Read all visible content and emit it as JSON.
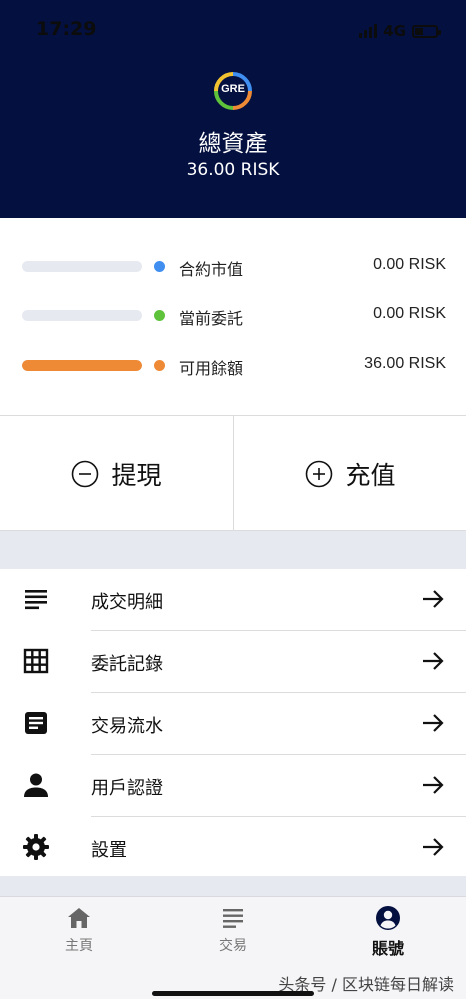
{
  "status_bar": {
    "time": "17:29",
    "network": "4G",
    "battery_level": 0.3
  },
  "header": {
    "logo_text": "GRE",
    "title": "總資產",
    "total_value": "36.00 RISK"
  },
  "breakdown": [
    {
      "label": "合約市值",
      "value": "0.00 RISK",
      "dot_color": "#3f8ef0",
      "fill_fraction": 0.0
    },
    {
      "label": "當前委託",
      "value": "0.00 RISK",
      "dot_color": "#5ec23b",
      "fill_fraction": 0.0
    },
    {
      "label": "可用餘額",
      "value": "36.00 RISK",
      "dot_color": "#ee8a36",
      "fill_fraction": 1.0
    }
  ],
  "actions": {
    "withdraw_label": "提現",
    "deposit_label": "充值"
  },
  "menu": [
    {
      "label": "成交明細",
      "icon": "list-lines-icon"
    },
    {
      "label": "委託記錄",
      "icon": "grid-icon"
    },
    {
      "label": "交易流水",
      "icon": "document-icon"
    },
    {
      "label": "用戶認證",
      "icon": "person-icon"
    },
    {
      "label": "設置",
      "icon": "gear-icon"
    }
  ],
  "tabs": [
    {
      "label": "主頁",
      "icon": "home-icon",
      "active": false
    },
    {
      "label": "交易",
      "icon": "list-lines-icon",
      "active": false
    },
    {
      "label": "賬號",
      "icon": "account-icon",
      "active": true
    }
  ],
  "watermark": "头条号 / 区块链每日解读",
  "colors": {
    "hero_bg": "#04103f",
    "accent_orange": "#ee8a36",
    "band_gray": "#e6e9f0"
  }
}
